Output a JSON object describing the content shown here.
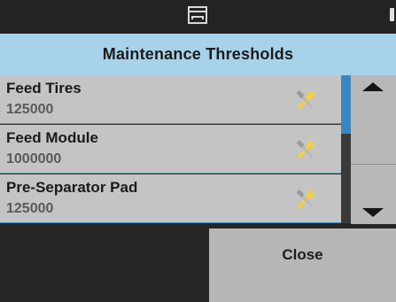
{
  "header": {
    "title": "Maintenance Thresholds"
  },
  "topbar": {
    "icons": [
      "window-icon"
    ]
  },
  "items": [
    {
      "name": "Feed Tires",
      "value": "125000",
      "icon": "wrench-hammer-icon"
    },
    {
      "name": "Feed Module",
      "value": "1000000",
      "icon": "wrench-hammer-icon"
    },
    {
      "name": "Pre-Separator Pad",
      "value": "125000",
      "icon": "wrench-hammer-icon"
    }
  ],
  "scroll": {
    "up_icon": "arrow-up-icon",
    "down_icon": "arrow-down-icon"
  },
  "footer": {
    "close_label": "Close"
  },
  "colors": {
    "header": "#a8d2ea",
    "row": "#c4c4c4",
    "accent": "#3a87c0",
    "tool_yellow": "#ffd21f",
    "background": "#262626"
  }
}
